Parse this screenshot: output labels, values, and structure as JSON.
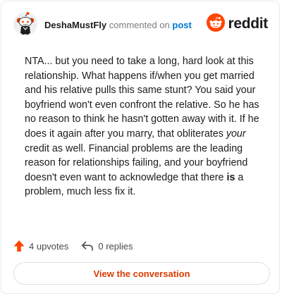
{
  "header": {
    "username": "DeshaMustFly",
    "action_text": "commented on",
    "post_link": "post",
    "brand_name": "reddit"
  },
  "comment": {
    "paragraph_before_italic": "NTA... but you need to take a long, hard look at this relationship. What happens if/when you get married and his relative pulls this same stunt? You said your boyfriend won't even confront the relative. So he has no reason to think he hasn't gotten away with it. If he does it again after you marry, that obliterates ",
    "italic_text": "your",
    "paragraph_after_italic": " credit as well. Financial problems are the leading reason for relationships failing, and your boyfriend doesn't even want to acknowledge that there ",
    "bold_text": "is",
    "paragraph_end": " a problem, much less fix it."
  },
  "actions": {
    "upvotes_label": "4 upvotes",
    "replies_label": "0 replies"
  },
  "cta": {
    "label": "View the conversation"
  },
  "colors": {
    "brand_orange": "#ff4500",
    "link_blue": "#0079d3",
    "cta_text": "#d93a00",
    "upvote_arrow": "#ff4500"
  },
  "icons": {
    "avatar": "snoo-avatar-icon",
    "brand": "reddit-logo-icon",
    "upvote": "upvote-arrow-icon",
    "reply": "reply-arrow-icon"
  }
}
